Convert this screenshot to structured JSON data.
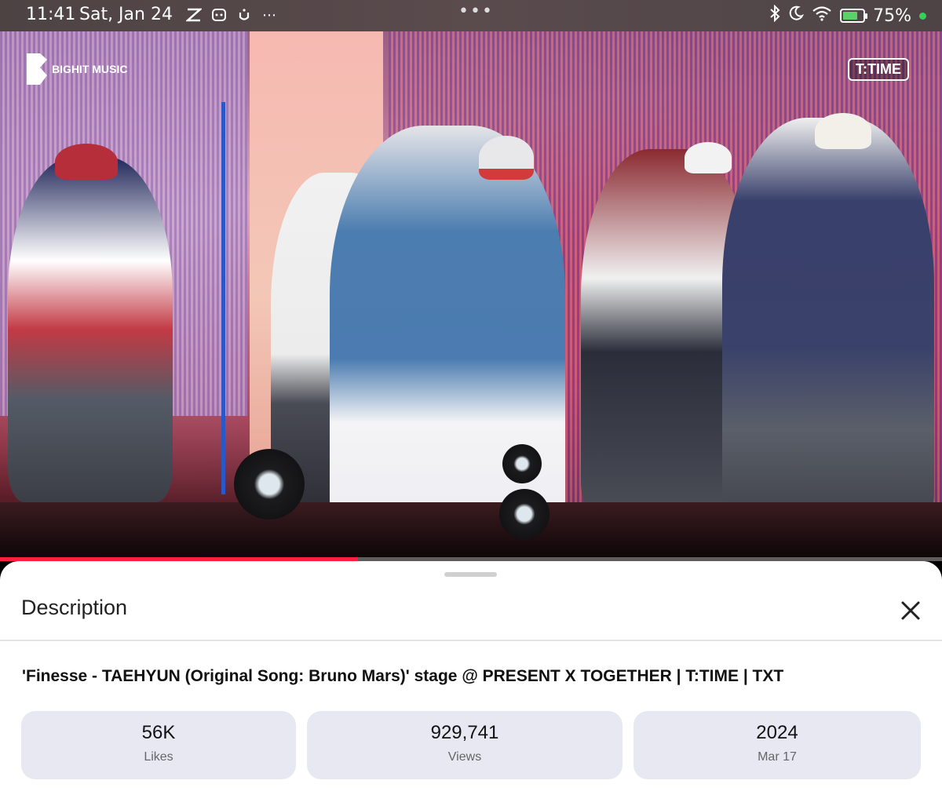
{
  "status_bar": {
    "time": "11:41",
    "date": "Sat, Jan 24",
    "battery_percent": "75%",
    "battery_level": 0.75,
    "icons_left": [
      "capcut-icon",
      "app-icon",
      "notification-icon",
      "more-dots-icon"
    ],
    "icons_right": [
      "bluetooth-icon",
      "moon-icon",
      "wifi-icon",
      "battery-icon"
    ]
  },
  "video": {
    "watermark_left": "BIGHIT MUSIC",
    "watermark_right": "T:TIME",
    "progress": 0.38,
    "progress_color": "#ff1e3c"
  },
  "sheet": {
    "title": "Description",
    "video_title": "'Finesse - TAEHYUN (Original Song: Bruno Mars)' stage @ PRESENT X TOGETHER | T:TIME | TXT",
    "stats": [
      {
        "value": "56K",
        "label": "Likes"
      },
      {
        "value": "929,741",
        "label": "Views"
      },
      {
        "value": "2024",
        "label": "Mar 17"
      }
    ],
    "stat_bg": "#e8e8f3"
  }
}
